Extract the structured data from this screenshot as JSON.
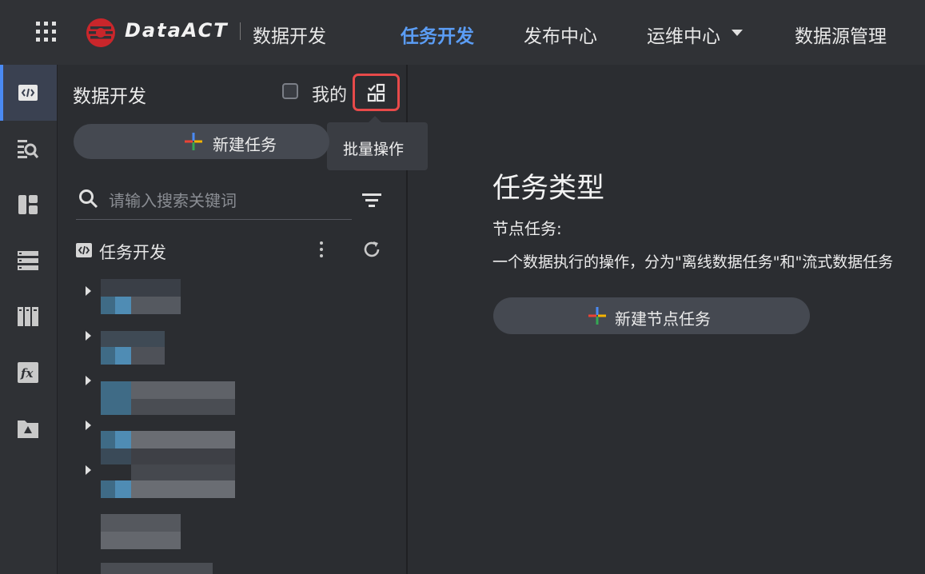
{
  "header": {
    "brand": "DataACT",
    "section": "数据开发",
    "nav": [
      {
        "label": "任务开发",
        "active": true
      },
      {
        "label": "发布中心",
        "active": false
      },
      {
        "label": "运维中心",
        "active": false,
        "has_dropdown": true
      },
      {
        "label": "数据源管理",
        "active": false
      }
    ]
  },
  "rail": {
    "icons": [
      "code-icon",
      "search-list-icon",
      "layout-icon",
      "table-icon",
      "library-icon",
      "function-icon",
      "folder-drive-icon"
    ],
    "active_index": 0
  },
  "panel": {
    "title": "数据开发",
    "mine_label": "我的",
    "mine_checked": false,
    "batch_tooltip": "批量操作",
    "new_task_label": "新建任务",
    "search_placeholder": "请输入搜索关键词",
    "tree_root_label": "任务开发"
  },
  "main": {
    "title": "任务类型",
    "subtitle": "节点任务:",
    "description": "一个数据执行的操作，分为\"离线数据任务\"和\"流式数据任务",
    "new_node_label": "新建节点任务"
  },
  "colors": {
    "accent": "#5b9df5",
    "highlight_border": "#e84a4a",
    "button_bg": "#454951"
  }
}
